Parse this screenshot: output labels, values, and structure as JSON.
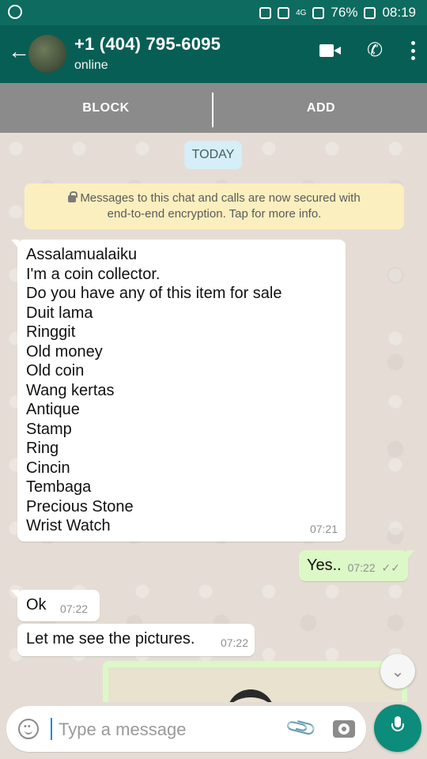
{
  "status_bar": {
    "network": "4G",
    "battery": "76%",
    "time": "08:19"
  },
  "header": {
    "contact_name": "+1 (404) 795-6095",
    "status": "online",
    "back_icon": "back-arrow-icon",
    "video_icon": "video-call-icon",
    "call_icon": "phone-icon",
    "menu_icon": "more-vert-icon"
  },
  "actions": {
    "block_label": "BLOCK",
    "add_label": "ADD"
  },
  "chat": {
    "date_label": "TODAY",
    "encryption_text_1": "Messages to this chat and calls are now secured with",
    "encryption_text_2": "end-to-end encryption. Tap for more info.",
    "messages": [
      {
        "direction": "incoming",
        "lines": [
          "Assalamualaiku",
          "I'm a coin collector.",
          "Do you have any of this item for sale",
          "Duit lama",
          "Ringgit",
          "Old money",
          "Old coin",
          "Wang kertas",
          "Antique",
          "Stamp",
          "Ring",
          "Cincin",
          "Tembaga",
          "Precious Stone",
          "Wrist Watch"
        ],
        "time": "07:21"
      },
      {
        "direction": "outgoing",
        "text": "Yes..",
        "time": "07:22",
        "ticks": "✓✓"
      },
      {
        "direction": "incoming",
        "text": "Ok",
        "time": "07:22"
      },
      {
        "direction": "incoming",
        "text": "Let me see the pictures.",
        "time": "07:22"
      }
    ]
  },
  "composer": {
    "placeholder": "Type a message",
    "emoji_icon": "emoji-icon",
    "attach_icon": "attach-icon",
    "camera_icon": "camera-icon",
    "mic_icon": "mic-icon"
  },
  "colors": {
    "header": "#075e54",
    "status_bar": "#0d6b5f",
    "outgoing_bubble": "#dcf8c6",
    "incoming_bubble": "#ffffff",
    "action_bar": "#8b8b8b",
    "mic_button": "#0c8c7b"
  }
}
